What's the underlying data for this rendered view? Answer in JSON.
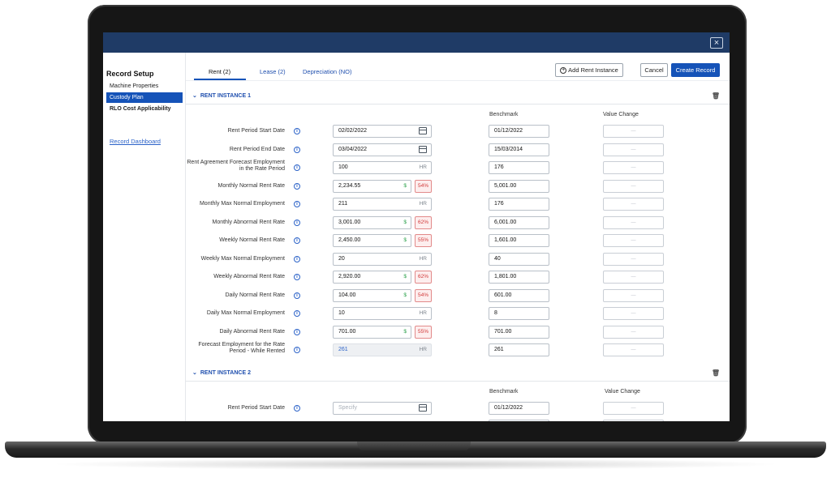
{
  "window": {
    "close_glyph": "×"
  },
  "sidebar": {
    "title": "Record Setup",
    "items": [
      {
        "label": "Machine Properties"
      },
      {
        "label": "Custody Plan"
      },
      {
        "label": "RLO Cost Applicability"
      }
    ],
    "dashboard_link": "Record Dashboard"
  },
  "tabs": [
    {
      "label": "Rent (2)"
    },
    {
      "label": "Lease (2)"
    },
    {
      "label": "Depreciation (NO)"
    }
  ],
  "toolbar": {
    "add_label": "Add Rent Instance",
    "cancel_label": "Cancel",
    "create_label": "Create Record"
  },
  "columns": {
    "benchmark": "Benchmark",
    "value_change": "Value Change"
  },
  "instance1": {
    "title": "RENT INSTANCE 1",
    "rows": [
      {
        "label": "Rent Period Start Date",
        "value": "02/02/2022",
        "kind": "date",
        "benchmark": "01/12/2022"
      },
      {
        "label": "Rent Period End Date",
        "value": "03/04/2022",
        "kind": "date",
        "benchmark": "15/03/2014"
      },
      {
        "label": "Rent Agreement Forecast Employment in the Rate Period",
        "value": "100",
        "kind": "hr",
        "unit": "HR",
        "benchmark": "176"
      },
      {
        "label": "Monthly Normal Rent Rate",
        "value": "2,234.55",
        "kind": "money",
        "unit": "$",
        "pct": "54%",
        "benchmark": "5,001.00"
      },
      {
        "label": "Monthly Max Normal Employment",
        "value": "211",
        "kind": "hr",
        "unit": "HR",
        "benchmark": "176"
      },
      {
        "label": "Monthly Abnormal Rent Rate",
        "value": "3,001.00",
        "kind": "money",
        "unit": "$",
        "pct": "62%",
        "benchmark": "6,001.00"
      },
      {
        "label": "Weekly Normal Rent Rate",
        "value": "2,450.00",
        "kind": "money",
        "unit": "$",
        "pct": "55%",
        "benchmark": "1,601.00"
      },
      {
        "label": "Weekly Max Normal Employment",
        "value": "20",
        "kind": "hr",
        "unit": "HR",
        "benchmark": "40"
      },
      {
        "label": "Weekly Abnormal Rent Rate",
        "value": "2,920.00",
        "kind": "money",
        "unit": "$",
        "pct": "62%",
        "benchmark": "1,801.00"
      },
      {
        "label": "Daily Normal Rent Rate",
        "value": "104.00",
        "kind": "money",
        "unit": "$",
        "pct": "54%",
        "benchmark": "601.00"
      },
      {
        "label": "Daily Max Normal Employment",
        "value": "10",
        "kind": "hr",
        "unit": "HR",
        "benchmark": "8"
      },
      {
        "label": "Daily Abnormal Rent Rate",
        "value": "701.00",
        "kind": "money",
        "unit": "$",
        "pct": "55%",
        "benchmark": "701.00"
      },
      {
        "label": "Forecast Employment for the Rate Period - While Rented",
        "value": "261",
        "kind": "readonly",
        "unit": "HR",
        "benchmark": "261"
      }
    ]
  },
  "instance2": {
    "title": "RENT INSTANCE 2",
    "rows": [
      {
        "label": "Rent Period Start Date",
        "placeholder": "Specify",
        "kind": "date",
        "benchmark": "01/12/2022"
      }
    ]
  },
  "value_change_placeholder": "—"
}
